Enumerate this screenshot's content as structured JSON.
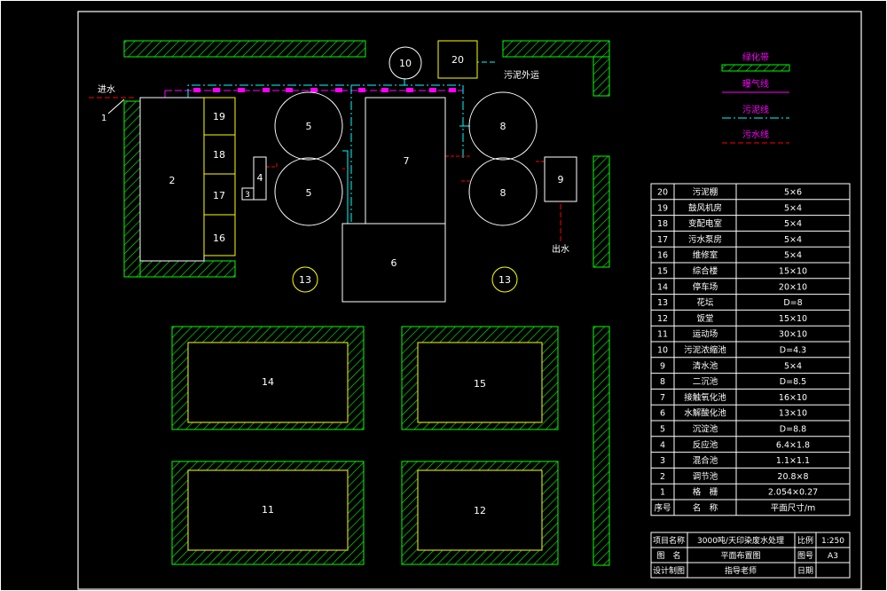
{
  "colors": {
    "background": "#000000",
    "frame": "#ffffff",
    "green_belt": "#00ff00",
    "gas_line": "#ff00ff",
    "sludge_line": "#00ffff",
    "sewage_line": "#ff0000",
    "number_circle": "#ffff00"
  },
  "labels": {
    "inlet": "进水",
    "outlet": "出水",
    "sludge_out": "污泥外运",
    "inlet_marker": "1"
  },
  "legend": {
    "green_belt": "绿化带",
    "gas_line": "曝气线",
    "sludge_line": "污泥线",
    "sewage_line": "污水线"
  },
  "units": {
    "u2": "2",
    "u3": "3",
    "u4": "4",
    "u5a": "5",
    "u5b": "5",
    "u6": "6",
    "u7": "7",
    "u8a": "8",
    "u8b": "8",
    "u9": "9",
    "u10": "10",
    "u11": "11",
    "u12": "12",
    "u13a": "13",
    "u13b": "13",
    "u14": "14",
    "u15": "15",
    "u16": "16",
    "u17": "17",
    "u18": "18",
    "u19": "19",
    "u20": "20"
  },
  "table": {
    "rows": [
      {
        "no": "20",
        "name": "污泥棚",
        "size": "5×6"
      },
      {
        "no": "19",
        "name": "鼓风机房",
        "size": "5×4"
      },
      {
        "no": "18",
        "name": "变配电室",
        "size": "5×4"
      },
      {
        "no": "17",
        "name": "污水泵房",
        "size": "5×4"
      },
      {
        "no": "16",
        "name": "维修室",
        "size": "5×4"
      },
      {
        "no": "15",
        "name": "综合楼",
        "size": "15×10"
      },
      {
        "no": "14",
        "name": "停车场",
        "size": "20×10"
      },
      {
        "no": "13",
        "name": "花坛",
        "size": "D=8"
      },
      {
        "no": "12",
        "name": "饭堂",
        "size": "15×10"
      },
      {
        "no": "11",
        "name": "运动场",
        "size": "30×10"
      },
      {
        "no": "10",
        "name": "污泥浓缩池",
        "size": "D=4.3"
      },
      {
        "no": "9",
        "name": "清水池",
        "size": "5×4"
      },
      {
        "no": "8",
        "name": "二沉池",
        "size": "D=8.5"
      },
      {
        "no": "7",
        "name": "接触氧化池",
        "size": "16×10"
      },
      {
        "no": "6",
        "name": "水解酸化池",
        "size": "13×10"
      },
      {
        "no": "5",
        "name": "沉淀池",
        "size": "D=8.8"
      },
      {
        "no": "4",
        "name": "反应池",
        "size": "6.4×1.8"
      },
      {
        "no": "3",
        "name": "混合池",
        "size": "1.1×1.1"
      },
      {
        "no": "2",
        "name": "调节池",
        "size": "20.8×8"
      },
      {
        "no": "1",
        "name": "格　栅",
        "size": "2.054×0.27"
      }
    ],
    "header": {
      "no": "序号",
      "name": "名　称",
      "size": "平面尺寸/m"
    },
    "title_block": {
      "project_label": "项目名称",
      "project_value": "3000吨/天印染废水处理",
      "scale_label": "比例",
      "scale_value": "1:250",
      "drawing_label": "图　名",
      "drawing_value": "平面布置图",
      "sheet_label": "图号",
      "sheet_value": "A3",
      "designer_label": "设计制图",
      "advisor_label": "指导老师",
      "date_label": "日期"
    }
  }
}
